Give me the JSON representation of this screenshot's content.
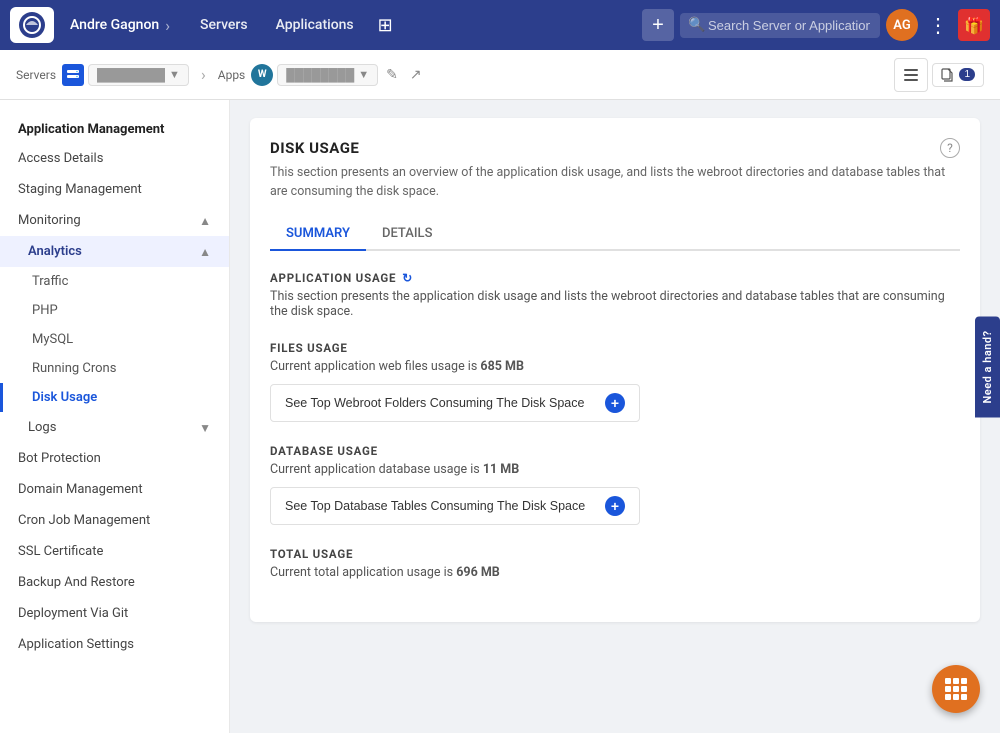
{
  "topnav": {
    "user": "Andre Gagnon",
    "servers_label": "Servers",
    "applications_label": "Applications",
    "add_btn_label": "+",
    "search_placeholder": "Search Server or Application",
    "gift_icon": "🎁"
  },
  "subbar": {
    "servers_label": "Servers",
    "server_icon_text": "V",
    "server_name": "Server",
    "apps_label": "Apps",
    "wp_icon_text": "W",
    "app_name": "App",
    "edit_icon": "✎",
    "external_icon": "↗",
    "files_badge": "1"
  },
  "sidebar": {
    "section_title": "Application Management",
    "items": [
      {
        "id": "access-details",
        "label": "Access Details"
      },
      {
        "id": "staging-management",
        "label": "Staging Management"
      },
      {
        "id": "monitoring",
        "label": "Monitoring",
        "expandable": true,
        "expanded": true
      },
      {
        "id": "analytics",
        "label": "Analytics",
        "expandable": true,
        "expanded": true,
        "sub": true
      },
      {
        "id": "traffic",
        "label": "Traffic",
        "subsub": true
      },
      {
        "id": "php",
        "label": "PHP",
        "subsub": true
      },
      {
        "id": "mysql",
        "label": "MySQL",
        "subsub": true
      },
      {
        "id": "running-crons",
        "label": "Running Crons",
        "subsub": true
      },
      {
        "id": "disk-usage",
        "label": "Disk Usage",
        "subsub": true,
        "active": true
      },
      {
        "id": "logs",
        "label": "Logs",
        "expandable": true,
        "sub": true
      },
      {
        "id": "bot-protection",
        "label": "Bot Protection"
      },
      {
        "id": "domain-management",
        "label": "Domain Management"
      },
      {
        "id": "cron-job-management",
        "label": "Cron Job Management"
      },
      {
        "id": "ssl-certificate",
        "label": "SSL Certificate"
      },
      {
        "id": "backup-restore",
        "label": "Backup And Restore"
      },
      {
        "id": "deployment-git",
        "label": "Deployment Via Git"
      },
      {
        "id": "application-settings",
        "label": "Application Settings"
      }
    ]
  },
  "main": {
    "card": {
      "title": "DISK USAGE",
      "description": "This section presents an overview of the application disk usage, and lists the webroot directories and database tables that are consuming the disk space.",
      "tabs": [
        {
          "id": "summary",
          "label": "SUMMARY",
          "active": true
        },
        {
          "id": "details",
          "label": "DETAILS",
          "active": false
        }
      ],
      "app_usage_title": "APPLICATION USAGE",
      "app_usage_desc": "This section presents the application disk usage and lists the webroot directories and database tables that are consuming the disk space.",
      "files_usage": {
        "title": "FILES USAGE",
        "desc_prefix": "Current application web files usage is ",
        "value": "685 MB",
        "btn_label": "See Top Webroot Folders Consuming The Disk Space"
      },
      "database_usage": {
        "title": "DATABASE USAGE",
        "desc_prefix": "Current application database usage is ",
        "value": "11 MB",
        "btn_label": "See Top Database Tables Consuming The Disk Space"
      },
      "total_usage": {
        "title": "TOTAL USAGE",
        "desc_prefix": "Current total application usage is ",
        "value": "696 MB"
      }
    }
  },
  "need_hand": "Need a hand?",
  "fab": "⊞"
}
